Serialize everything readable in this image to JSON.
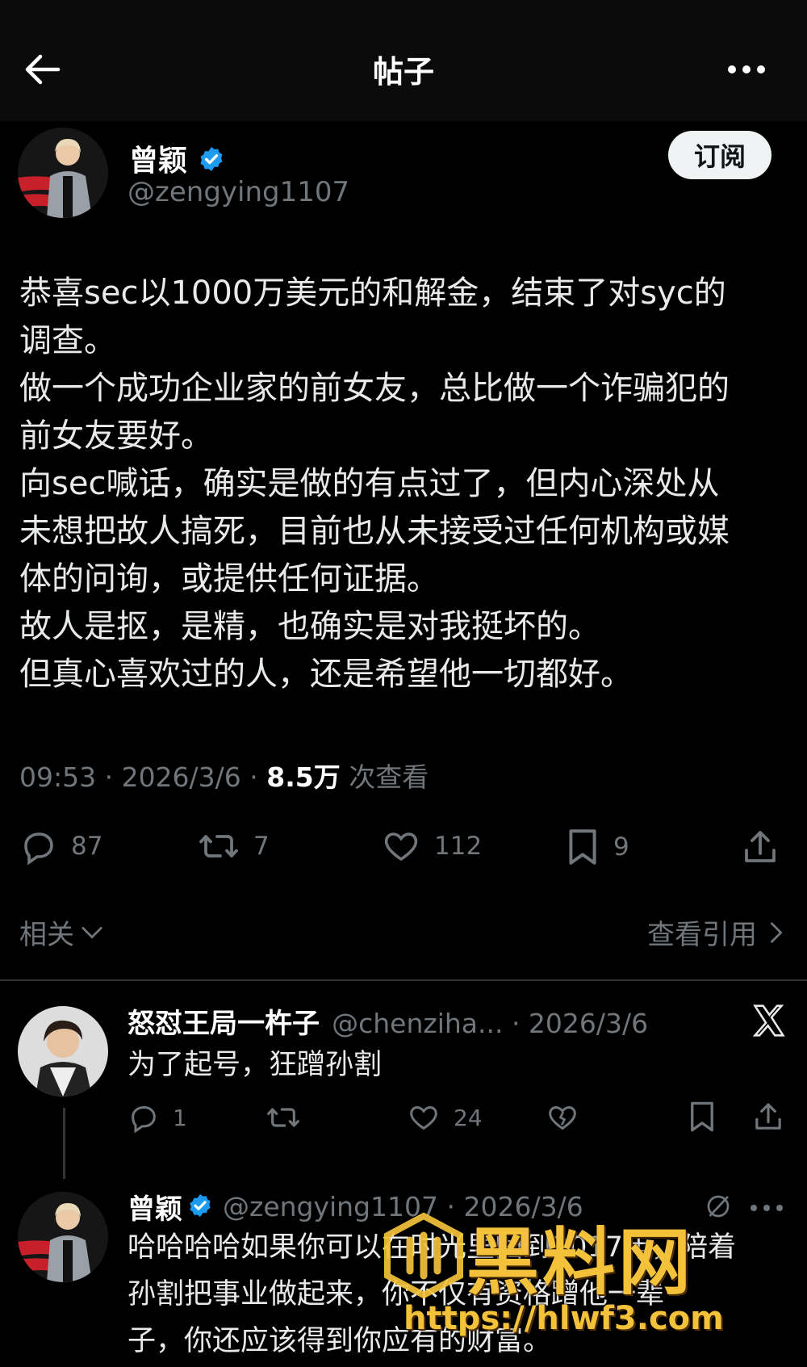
{
  "header": {
    "title": "帖子"
  },
  "post": {
    "author": {
      "name": "曾颖",
      "handle": "@zengying1107"
    },
    "subscribe_label": "订阅",
    "lines": [
      "恭喜sec以1000万美元的和解金，结束了对syc的",
      "调查。",
      "做一个成功企业家的前女友，总比做一个诈骗犯的",
      "前女友要好。",
      "向sec喊话，确实是做的有点过了，但内心深处从",
      "未想把故人搞死，目前也从未接受过任何机构或媒",
      "体的问询，或提供任何证据。",
      "故人是抠，是精，也确实是对我挺坏的。",
      "但真心喜欢过的人，还是希望他一切都好。"
    ],
    "time": "09:53 · 2026/3/6 · ",
    "views_count": "8.5万",
    "views_label": " 次查看",
    "stats": {
      "replies": "87",
      "reposts": "7",
      "likes": "112",
      "bookmarks": "9"
    }
  },
  "related_label": "相关",
  "quotes_label": "查看引用",
  "replies": [
    {
      "name": "怒怼王局一杵子",
      "meta": "@chenziha... · 2026/3/6",
      "text_lines": [
        "为了起号，狂蹭孙割"
      ],
      "stats": {
        "replies": "1",
        "reposts": "",
        "likes": "24"
      }
    },
    {
      "name": "曾颖",
      "meta": "@zengying1107 · 2026/3/6",
      "text_lines": [
        "哈哈哈哈如果你可以在时光里回到2017年，陪着",
        "孙割把事业做起来，你不仅有资格蹭他一辈",
        "子，你还应该得到你应有的财富。"
      ]
    }
  ],
  "watermark": {
    "text": "黑料网",
    "url": "https://hlwf3.com"
  },
  "colors": {
    "verified": "#1d9bf0",
    "background": "#000000",
    "muted": "#71767b"
  }
}
